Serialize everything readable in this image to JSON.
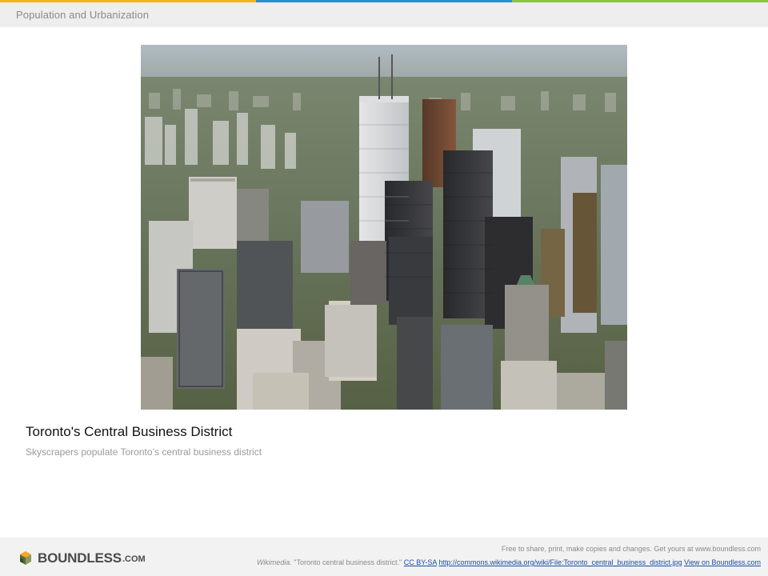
{
  "header": {
    "title": "Population and Urbanization",
    "stripe_colors": [
      "#f5b21b",
      "#2b8fd1",
      "#8cc63f"
    ]
  },
  "photo": {
    "alt": "Toronto central business district"
  },
  "caption": {
    "title": "Toronto's Central Business District",
    "subtitle": "Skyscrapers populate Toronto’s central business district"
  },
  "footer": {
    "brand": "BOUNDLESS",
    "brand_suffix": ".COM",
    "share_text": "Free to share, print, make copies and changes. Get yours at www.boundless.com",
    "credit_source": "Wikimedia.",
    "credit_text": " \"Toronto central business district.\" ",
    "license_label": "CC BY-SA",
    "source_url_label": "http://commons.wikimedia.org/wiki/File:Toronto_central_business_district.jpg",
    "view_label": "View on Boundless.com"
  }
}
